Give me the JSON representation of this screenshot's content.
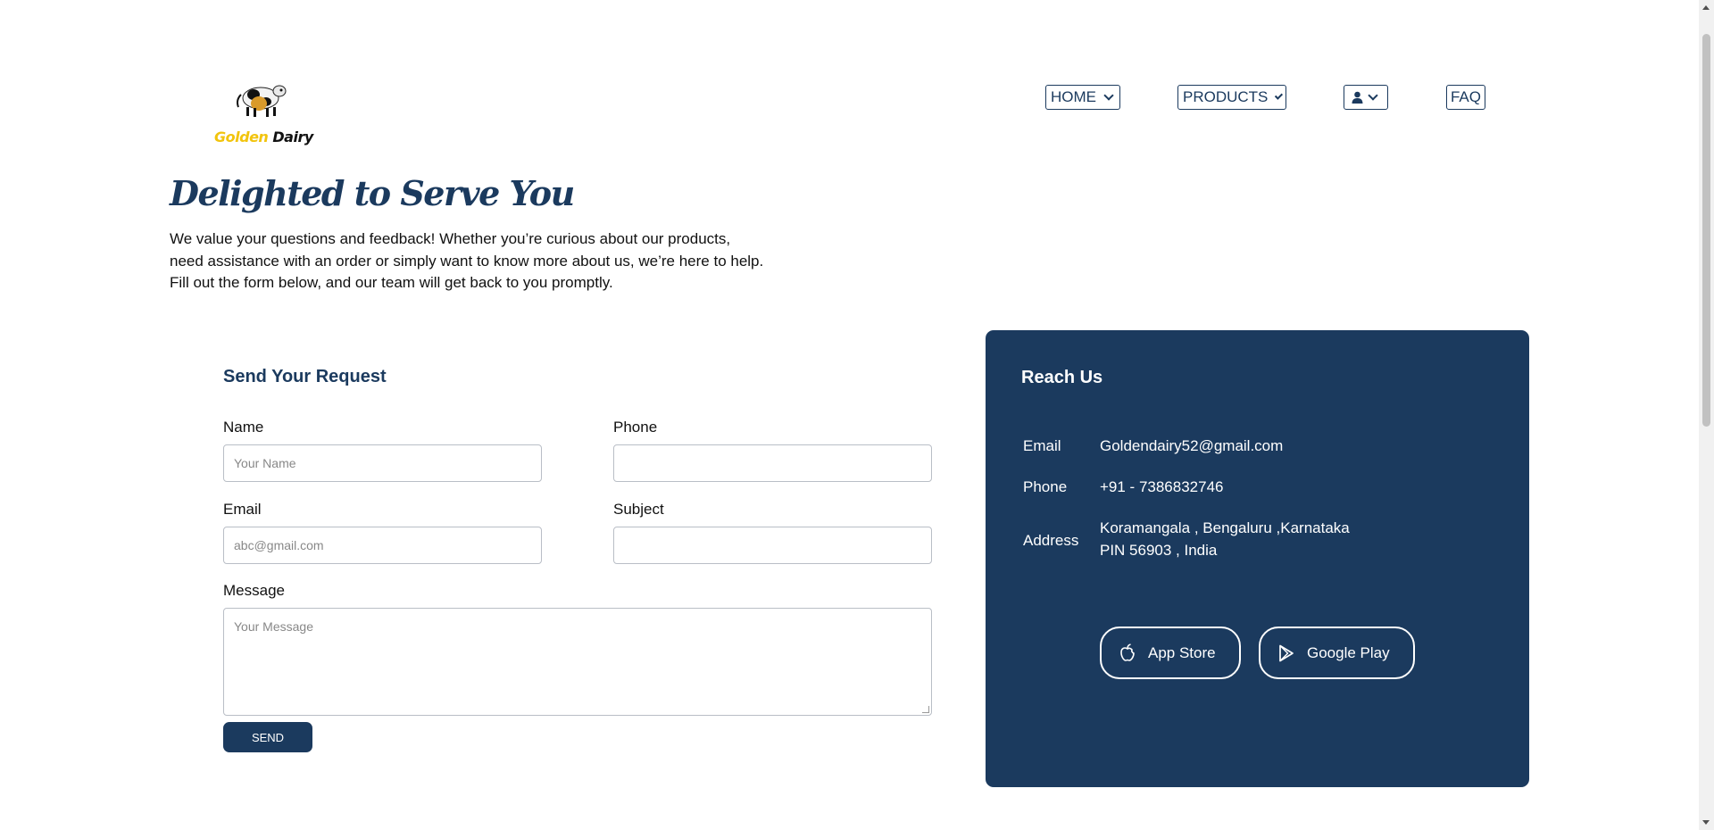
{
  "brand": {
    "word1": "Golden",
    "word2": "Dairy",
    "gold_color": "#f2c40d"
  },
  "nav": {
    "home": "HOME",
    "products": "PRODUCTS",
    "faq": "FAQ"
  },
  "intro": {
    "title": "Delighted to Serve You",
    "line1": "We value your questions and feedback! Whether you’re curious about our products,",
    "line2": "need assistance with an order or simply want to know more about us, we’re here to help.",
    "line3": "Fill out the form below, and our team will get back to you promptly."
  },
  "form": {
    "title": "Send Your Request",
    "name_label": "Name",
    "name_placeholder": "Your Name",
    "phone_label": "Phone",
    "phone_placeholder": "",
    "email_label": "Email",
    "email_placeholder": "abc@gmail.com",
    "subject_label": "Subject",
    "subject_placeholder": "",
    "message_label": "Message",
    "message_placeholder": "Your Message",
    "send_label": "SEND"
  },
  "reach": {
    "title": "Reach Us",
    "email_label": "Email",
    "email_value": "Goldendairy52@gmail.com",
    "phone_label": "Phone",
    "phone_value": "+91 - 7386832746",
    "address_label": "Address",
    "address_line1": "Koramangala , Bengaluru ,Karnataka",
    "address_line2": "PIN 56903 , India",
    "app_store_label": "App Store",
    "google_play_label": "Google Play"
  },
  "colors": {
    "primary": "#1b3a5e",
    "white": "#ffffff"
  },
  "icons": {
    "profile": "user-icon",
    "apple": "apple-icon",
    "play": "play-store-icon"
  }
}
